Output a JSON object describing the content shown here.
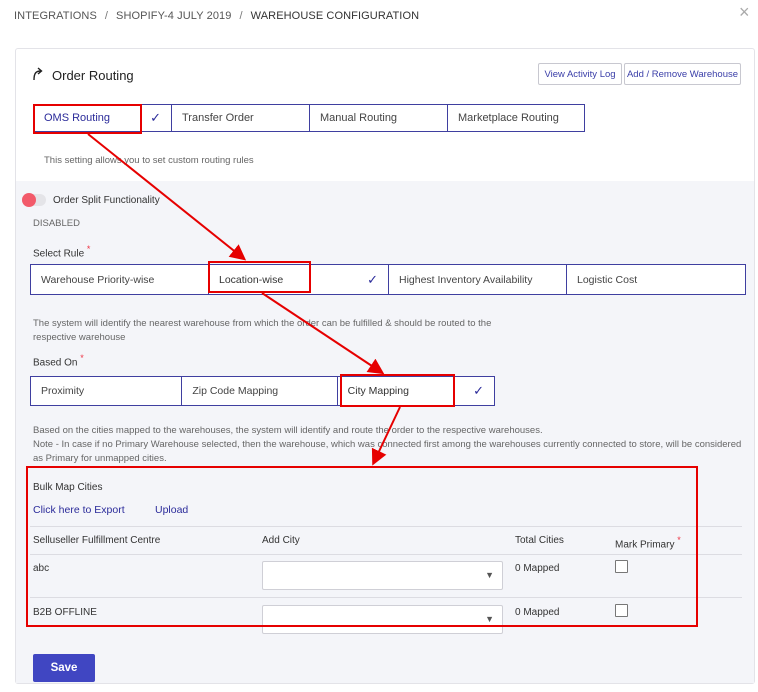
{
  "breadcrumb": {
    "items": [
      "INTEGRATIONS",
      "SHOPIFY-4 JULY 2019",
      "WAREHOUSE CONFIGURATION"
    ],
    "separator": "/"
  },
  "close_glyph": "×",
  "header": {
    "title": "Order Routing",
    "title_icon": "routing-arrow-icon",
    "view_activity_log": "View Activity Log",
    "add_remove_warehouse": "Add / Remove Warehouse"
  },
  "routing_tabs": {
    "items": [
      "OMS Routing",
      "Transfer Order",
      "Manual Routing",
      "Marketplace Routing"
    ],
    "selected": "OMS Routing",
    "helper": "This setting allows you to set custom routing rules"
  },
  "order_split": {
    "label": "Order Split Functionality",
    "status": "DISABLED"
  },
  "select_rule": {
    "label": "Select Rule",
    "required_mark": "*",
    "options": [
      "Warehouse Priority-wise",
      "Location-wise",
      "Highest Inventory Availability",
      "Logistic Cost"
    ],
    "selected": "Location-wise",
    "helper": "The system will identify the nearest warehouse from which the order can be fulfilled & should be routed to the respective warehouse"
  },
  "based_on": {
    "label": "Based On",
    "required_mark": "*",
    "options": [
      "Proximity",
      "Zip Code Mapping",
      "City Mapping"
    ],
    "selected": "City Mapping",
    "helper_line1": "Based on the cities mapped to the warehouses, the system will identify and route the order to the respective warehouses.",
    "helper_line2": "Note - In case if no Primary Warehouse selected, then the warehouse, which was connected first among the warehouses currently connected to store, will be considered as Primary for unmapped cities."
  },
  "bulk_map": {
    "title": "Bulk Map Cities",
    "export_link": "Click here to Export",
    "upload_link": "Upload"
  },
  "table": {
    "headers": {
      "centre": "Selluseller Fulfillment Centre",
      "add_city": "Add City",
      "total_cities": "Total Cities",
      "mark_primary": "Mark Primary",
      "required_mark": "*"
    },
    "rows": [
      {
        "centre": "abc",
        "total": "0 Mapped"
      },
      {
        "centre": "B2B OFFLINE",
        "total": "0 Mapped"
      }
    ]
  },
  "save_label": "Save",
  "colors": {
    "accent": "#2b2b9a",
    "annotation": "#e60000",
    "toggle_knob": "#f25a6a",
    "save_button": "#4046c2"
  }
}
